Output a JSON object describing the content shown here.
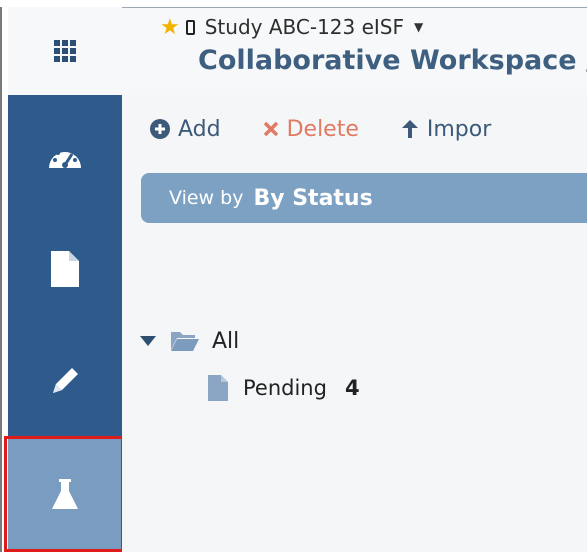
{
  "header": {
    "study_title": "Study ABC-123 eISF",
    "workspace_title": "Collaborative Workspace /"
  },
  "sidebar": {
    "items": [
      {
        "name": "dashboard"
      },
      {
        "name": "documents"
      },
      {
        "name": "edit"
      },
      {
        "name": "lab",
        "active": true
      }
    ]
  },
  "toolbar": {
    "add_label": "Add",
    "delete_label": "Delete",
    "import_label": "Impor"
  },
  "view_bar": {
    "label": "View by",
    "value": "By Status"
  },
  "tree": {
    "root_label": "All",
    "children": [
      {
        "label": "Pending",
        "count": "4"
      }
    ]
  },
  "colors": {
    "sidebar": "#2f5b8c",
    "sidebar_active": "#7a9cc0",
    "view_bar": "#7da1c3",
    "highlight": "#e01b1b",
    "star": "#f2b200"
  }
}
